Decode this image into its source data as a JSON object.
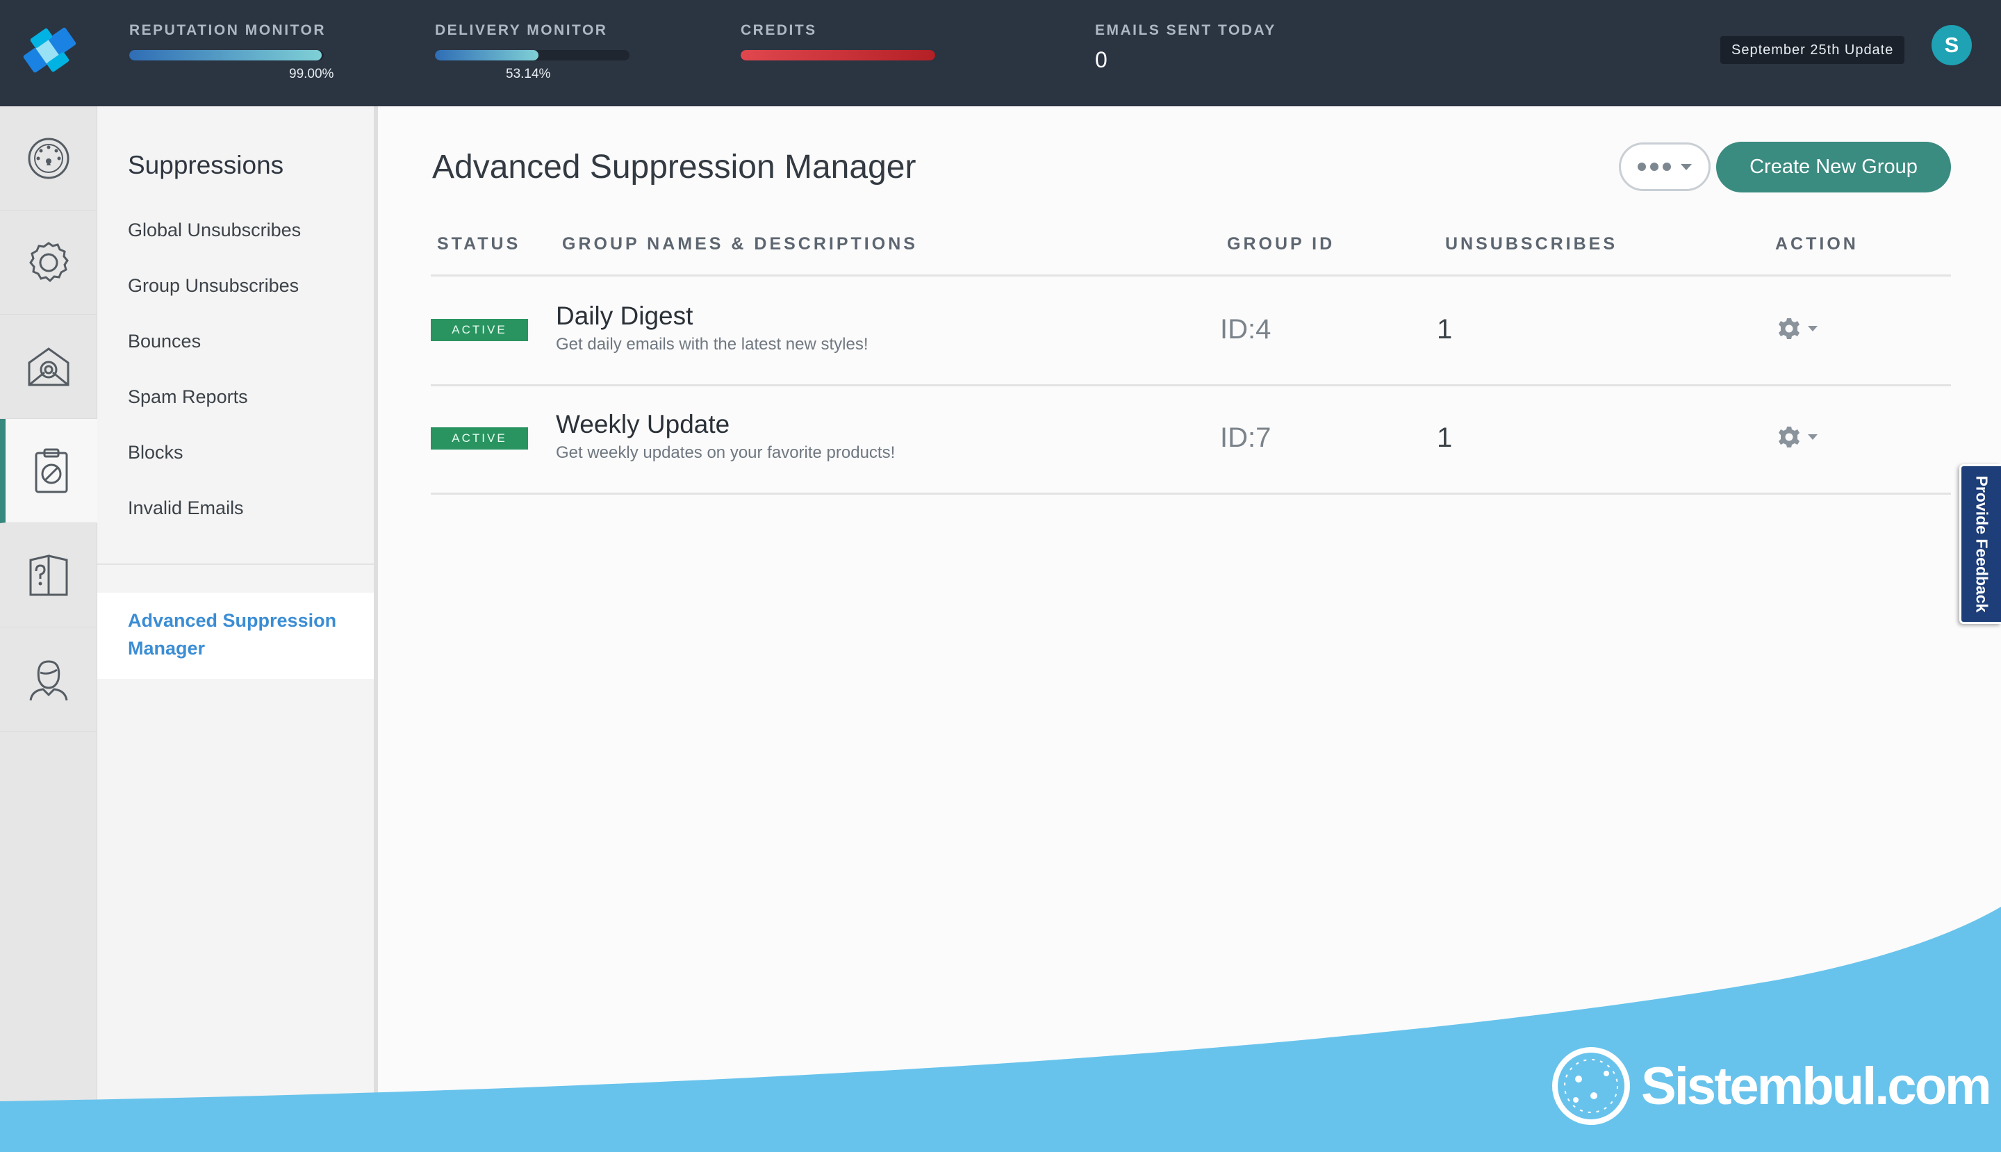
{
  "topbar": {
    "metrics": [
      {
        "label": "REPUTATION MONITOR",
        "percent_text": "99.00%",
        "fill": 0.99,
        "color_start": "#2f6db5",
        "color_end": "#7fd0d6"
      },
      {
        "label": "DELIVERY MONITOR",
        "percent_text": "53.14%",
        "fill": 0.5314,
        "color_start": "#2f6db5",
        "color_end": "#7fd0d6"
      },
      {
        "label": "CREDITS",
        "fill": 1.0,
        "color_start": "#e0474e",
        "color_end": "#b32025"
      },
      {
        "label": "EMAILS SENT TODAY",
        "value": "0"
      }
    ],
    "update_label": "September 25th Update",
    "avatar_initial": "S"
  },
  "rail": {
    "items": [
      {
        "icon": "dashboard-gauge-icon"
      },
      {
        "icon": "settings-gear-icon"
      },
      {
        "icon": "mail-envelope-icon"
      },
      {
        "icon": "suppressions-clipboard-icon",
        "active": true
      },
      {
        "icon": "help-document-icon"
      },
      {
        "icon": "account-person-icon"
      }
    ]
  },
  "subnav": {
    "title": "Suppressions",
    "items": [
      {
        "label": "Global Unsubscribes"
      },
      {
        "label": "Group Unsubscribes"
      },
      {
        "label": "Bounces"
      },
      {
        "label": "Spam Reports"
      },
      {
        "label": "Blocks"
      },
      {
        "label": "Invalid Emails"
      }
    ],
    "active_label": "Advanced Suppression Manager"
  },
  "main": {
    "title": "Advanced Suppression Manager",
    "more_icon": "ellipsis-icon",
    "create_button": "Create New Group",
    "headers": {
      "status": "STATUS",
      "group": "GROUP NAMES & DESCRIPTIONS",
      "id": "GROUP ID",
      "unsubscribes": "UNSUBSCRIBES",
      "action": "ACTION"
    },
    "rows": [
      {
        "status": "ACTIVE",
        "name": "Daily Digest",
        "description": "Get daily emails with the latest new styles!",
        "group_id": "ID:4",
        "unsubscribes": "1"
      },
      {
        "status": "ACTIVE",
        "name": "Weekly Update",
        "description": "Get weekly updates on your favorite products!",
        "group_id": "ID:7",
        "unsubscribes": "1"
      }
    ],
    "status_color": "#2a9461",
    "accent_color": "#3a8b80"
  },
  "feedback_label": "Provide Feedback",
  "watermark": "Sistembul.com"
}
